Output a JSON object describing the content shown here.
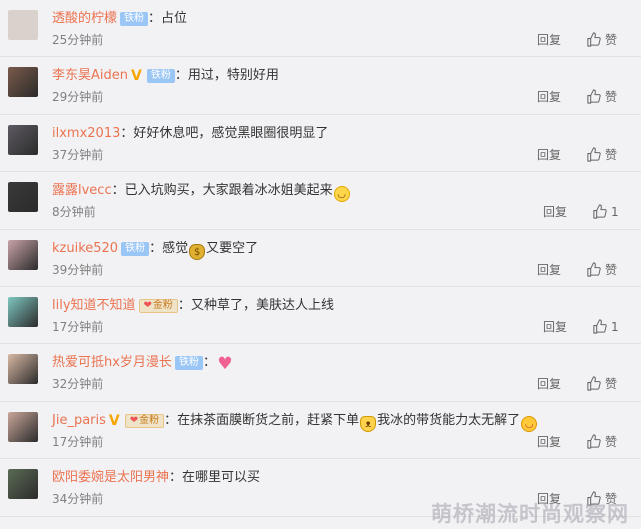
{
  "comments": [
    {
      "user": "透酸的柠檬",
      "verified": false,
      "badge": "铁粉",
      "badge_type": "plain",
      "text": "占位",
      "emoji": "",
      "emoji_mid": "",
      "text2": "",
      "emoji_end": "",
      "time": "25分钟前",
      "reply": "回复",
      "like": "赞",
      "avatar_color": "#d9d2cc"
    },
    {
      "user": "李东昊Aiden",
      "verified": true,
      "badge": "铁粉",
      "badge_type": "plain",
      "text": "用过，特别好用",
      "emoji": "",
      "emoji_mid": "",
      "text2": "",
      "emoji_end": "",
      "time": "29分钟前",
      "reply": "回复",
      "like": "赞",
      "avatar_color": "#7a5a4a"
    },
    {
      "user": "ilxmx2013",
      "verified": false,
      "badge": "",
      "badge_type": "",
      "text": "好好休息吧，感觉黑眼圈很明显了",
      "emoji": "",
      "emoji_mid": "",
      "text2": "",
      "emoji_end": "",
      "time": "37分钟前",
      "reply": "回复",
      "like": "赞",
      "avatar_color": "#5d5a62"
    },
    {
      "user": "露露lvecc",
      "verified": false,
      "badge": "",
      "badge_type": "",
      "text": "已入坑购买，大家跟着冰冰姐美起来",
      "emoji": "",
      "emoji_mid": "",
      "text2": "",
      "emoji_end": "grin",
      "time": "8分钟前",
      "reply": "回复",
      "like": "1",
      "avatar_color": "#3a3a3a"
    },
    {
      "user": "kzuike520",
      "verified": false,
      "badge": "铁粉",
      "badge_type": "plain",
      "text": "感觉",
      "emoji": "",
      "emoji_mid": "bag",
      "text2": "又要空了",
      "emoji_end": "",
      "time": "39分钟前",
      "reply": "回复",
      "like": "赞",
      "avatar_color": "#c9a3a8"
    },
    {
      "user": "lily知道不知道",
      "verified": false,
      "badge": "金粉",
      "badge_type": "gold",
      "text": "又种草了，美肤达人上线",
      "emoji": "",
      "emoji_mid": "",
      "text2": "",
      "emoji_end": "",
      "time": "17分钟前",
      "reply": "回复",
      "like": "1",
      "avatar_color": "#7fc7c0"
    },
    {
      "user": "热爱可抵hx岁月漫长",
      "verified": false,
      "badge": "铁粉",
      "badge_type": "plain",
      "text": "",
      "emoji": "",
      "emoji_mid": "",
      "text2": "",
      "emoji_end": "heart",
      "time": "32分钟前",
      "reply": "回复",
      "like": "赞",
      "avatar_color": "#d8b9a4"
    },
    {
      "user": "Jie_paris",
      "verified": true,
      "badge": "金粉",
      "badge_type": "gold",
      "text": "在抹茶面膜断货之前，赶紧下单",
      "emoji": "",
      "emoji_mid": "cat",
      "text2": "我冰的带货能力太无解了",
      "emoji_end": "tongue",
      "time": "17分钟前",
      "reply": "回复",
      "like": "赞",
      "avatar_color": "#caa79a"
    },
    {
      "user": "欧阳委婉是太阳男神",
      "verified": false,
      "badge": "",
      "badge_type": "",
      "text": "在哪里可以买",
      "emoji": "",
      "emoji_mid": "",
      "text2": "",
      "emoji_end": "",
      "time": "34分钟前",
      "reply": "回复",
      "like": "赞",
      "avatar_color": "#5b6b55"
    }
  ],
  "watermark": "萌桥潮流时尚观察网",
  "colors": {
    "username": "#eb7350",
    "badge": "#9ac6f5",
    "verified": "#f7a600",
    "background": "#f2f2f5"
  },
  "icons": {
    "like": "thumbs-up-icon",
    "verified": "verified-v-icon"
  }
}
